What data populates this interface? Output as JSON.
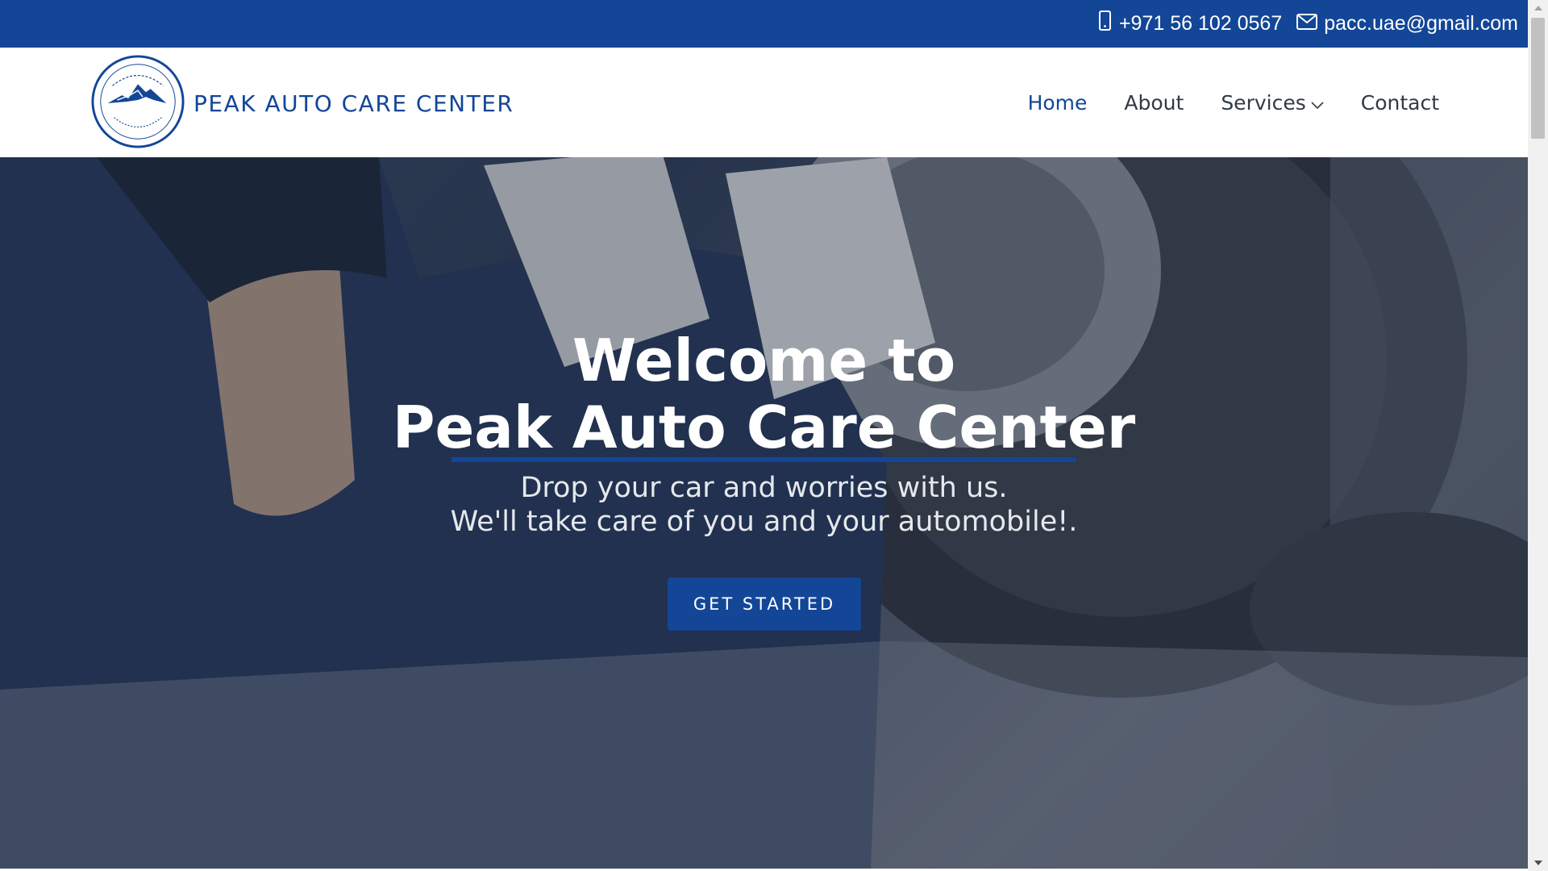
{
  "topbar": {
    "phone": "+971 56 102 0567",
    "email": "pacc.uae@gmail.com",
    "phone_icon": "mobile-phone-icon",
    "email_icon": "envelope-icon"
  },
  "header": {
    "brand_name": "PEAK AUTO CARE CENTER",
    "logo_text": "PEAK AUTO CARE CENTRE L.L.C"
  },
  "nav": {
    "items": [
      {
        "label": "Home",
        "active": true
      },
      {
        "label": "About",
        "active": false
      },
      {
        "label": "Services",
        "active": false,
        "dropdown": true
      },
      {
        "label": "Contact",
        "active": false
      }
    ]
  },
  "hero": {
    "title_line1": "Welcome to",
    "title_line2": "Peak Auto Care Center",
    "subtitle_line1": "Drop your car and worries with us.",
    "subtitle_line2": "We'll take care of you and your automobile!.",
    "cta_label": "GET STARTED"
  },
  "colors": {
    "brand_blue": "#134697",
    "nav_text": "#333a44"
  }
}
